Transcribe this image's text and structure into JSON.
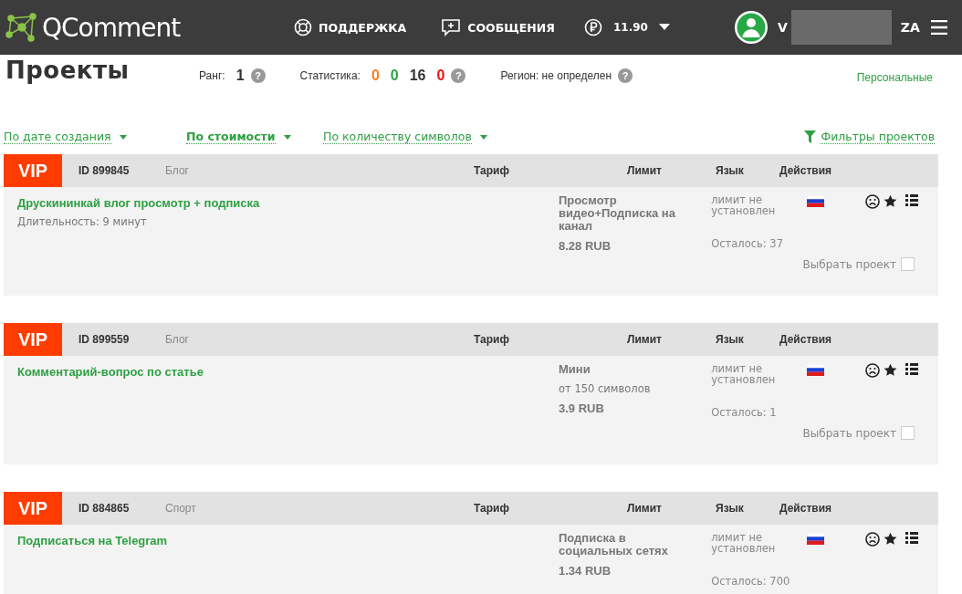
{
  "header": {
    "logo": "QComment",
    "nav": [
      {
        "label": "ПОДДЕРЖКА",
        "kind": "support"
      },
      {
        "label": "СООБЩЕНИЯ",
        "kind": "messages"
      }
    ],
    "balance": "11.90",
    "user": {
      "name_start": "V",
      "name_end": "ZA"
    }
  },
  "page": {
    "title": "Проекты",
    "rank_label": "Ранг:",
    "rank": "1",
    "rank_help": "?",
    "stats_label": "Статистика:",
    "stats": [
      {
        "value": "0",
        "color": "#f7801e"
      },
      {
        "value": "0",
        "color": "#2ea043"
      },
      {
        "value": "16",
        "color": "#333333"
      },
      {
        "value": "0",
        "color": "#ee1111"
      }
    ],
    "stats_help": "?",
    "region": "Регион: не определен",
    "region_help": "?",
    "personal": "Персональные"
  },
  "sorts": [
    {
      "label": "По дате создания",
      "selected": false
    },
    {
      "label": "По стоимости",
      "selected": true
    },
    {
      "label": "По количеству символов",
      "selected": false
    }
  ],
  "filters": "Фильтры проектов",
  "projects": [
    {
      "badge": "VIP",
      "id": "ID 899845",
      "category": "Блог",
      "columns": [
        "Тариф",
        "Лимит",
        "Язык",
        "Действия"
      ],
      "title": "Друскининкай влог просмотр + подписка",
      "note": "Длительность: 9 минут",
      "tariff": "Просмотр видео+Подписка на канал",
      "price": "8.28 RUB",
      "limit": "лимит не установлен",
      "left": "Осталось: 37",
      "select": {
        "label": "Выбрать проект",
        "checked": false
      }
    },
    {
      "badge": "VIP",
      "id": "ID 899559",
      "category": "Блог",
      "columns": [
        "Тариф",
        "Лимит",
        "Язык",
        "Действия"
      ],
      "title": "Комментарий-вопрос по статье",
      "tariff": "Мини",
      "tariff_note": "от 150 символов",
      "price": "3.9 RUB",
      "limit": "лимит не установлен",
      "left": "Осталось: 1",
      "select": {
        "label": "Выбрать проект",
        "checked": false
      }
    },
    {
      "badge": "VIP",
      "id": "ID 884865",
      "category": "Спорт",
      "columns": [
        "Тариф",
        "Лимит",
        "Язык",
        "Действия"
      ],
      "title": "Подписаться на Telegram",
      "tariff": "Подписка в социальных сетях",
      "price": "1.34 RUB",
      "limit": "лимит не установлен",
      "left": "Осталось: 700"
    }
  ]
}
